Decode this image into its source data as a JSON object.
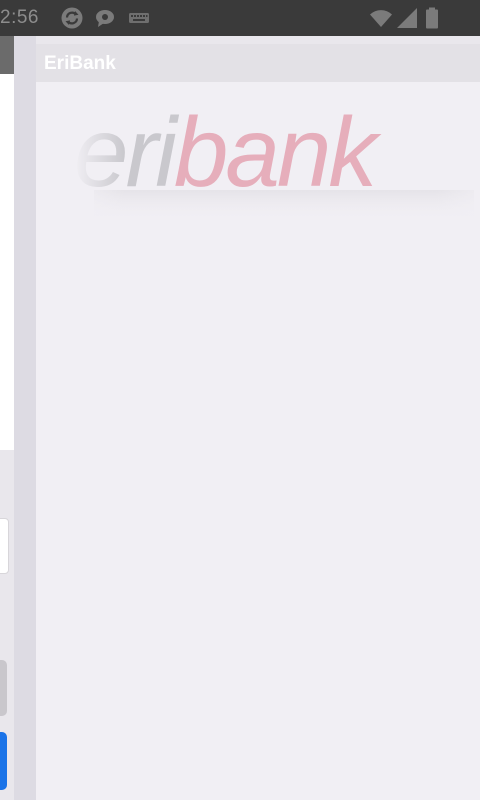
{
  "status_bar": {
    "time": "2:56",
    "icons": [
      "sync-icon",
      "chat-bubble-icon",
      "keyboard-icon",
      "wifi-icon",
      "cell-signal-icon",
      "battery-icon"
    ]
  },
  "app": {
    "title": "EriBank",
    "logo": {
      "text_grey": "eri",
      "text_red": "bank",
      "colors": {
        "grey": "#c9c8cd",
        "red": "#e6aebb"
      }
    }
  },
  "colors": {
    "status_bar_bg": "#3a3a3a",
    "panel_bg": "#f1eff4",
    "app_bar_bg": "#e3e1e6",
    "button_blue": "#1a73e8"
  }
}
